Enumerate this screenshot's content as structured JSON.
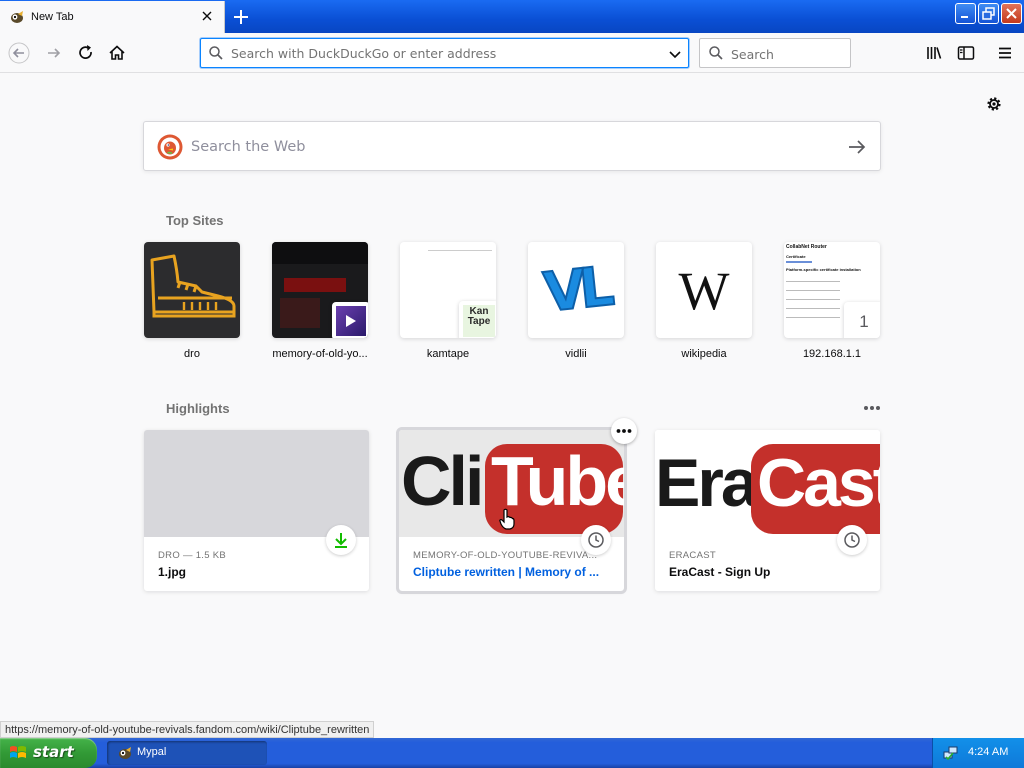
{
  "browser": {
    "tab": {
      "title": "New Tab",
      "close_icon": "close-icon"
    },
    "new_tab_icon": "plus-icon",
    "window_controls": [
      "minimize",
      "restore",
      "close"
    ]
  },
  "navbar": {
    "urlbar_placeholder": "Search with DuckDuckGo or enter address",
    "searchbar_placeholder": "Search"
  },
  "newtab": {
    "websearch_placeholder": "Search the Web",
    "top_sites_title": "Top Sites",
    "top_sites": [
      {
        "label": "dro"
      },
      {
        "label": "memory-of-old-yo..."
      },
      {
        "label": "kamtape",
        "mini_text": "Kan Tape"
      },
      {
        "label": "vidlii",
        "logo_text": "VL"
      },
      {
        "label": "wikipedia",
        "logo_text": "W"
      },
      {
        "label": "192.168.1.1",
        "mini_text": "1",
        "doc_title": "CollabNet Router",
        "doc_sub": "Certificate",
        "doc_head": "Platform-specific certificate installation"
      }
    ],
    "highlights_title": "Highlights",
    "highlights": [
      {
        "context": "DRO — 1.5 KB",
        "title": "1.jpg",
        "badge": "download-icon"
      },
      {
        "context": "MEMORY-OF-OLD-YOUTUBE-REVIVA...",
        "title": "Cliptube rewritten | Memory of ...",
        "badge": "clock-icon",
        "preview_text": [
          "Clip",
          "Tube"
        ]
      },
      {
        "context": "ERACAST",
        "title": "EraCast - Sign Up",
        "badge": "clock-icon",
        "preview_text": [
          "Era",
          "Cast"
        ]
      }
    ]
  },
  "status_url": "https://memory-of-old-youtube-revivals.fandom.com/wiki/Cliptube_rewritten",
  "taskbar": {
    "start_label": "start",
    "window_label": "Mypal",
    "clock": "4:24 AM"
  },
  "colors": {
    "accent": "#0a84ff",
    "taskbar": "#245edb",
    "start": "#329a36",
    "youtube_red": "#c4302b"
  }
}
